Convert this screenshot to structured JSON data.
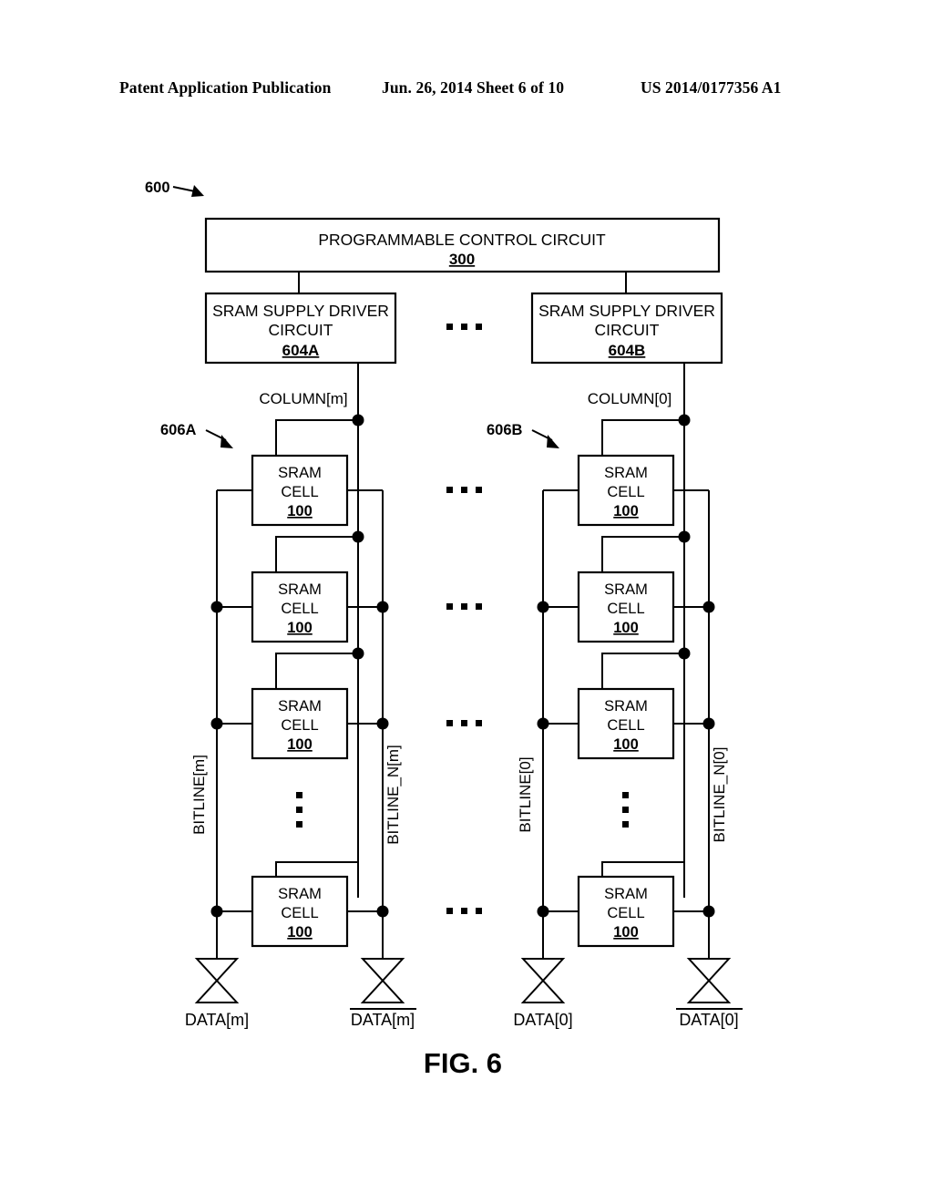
{
  "header": {
    "left": "Patent Application Publication",
    "middle": "Jun. 26, 2014  Sheet 6 of 10",
    "right": "US 2014/0177356 A1"
  },
  "figure": {
    "caption": "FIG. 6",
    "diagram_ref": "600",
    "control_circuit": {
      "title": "PROGRAMMABLE CONTROL CIRCUIT",
      "ref": "300"
    },
    "ellipsis_horizontal": "...",
    "ellipsis_vertical": "⋮",
    "drivers": [
      {
        "line1": "SRAM SUPPLY DRIVER",
        "line2": "CIRCUIT",
        "ref": "604A"
      },
      {
        "line1": "SRAM SUPPLY DRIVER",
        "line2": "CIRCUIT",
        "ref": "604B"
      }
    ],
    "columns": [
      {
        "supply_label": "COLUMN[m]",
        "array_ref": "606A",
        "bitline_true": "BITLINE[m]",
        "bitline_complement": "BITLINE_N[m]",
        "data_true": "DATA[m]",
        "data_complement": "DATA[m]",
        "data_complement_overlined": true,
        "cells": [
          {
            "line1": "SRAM",
            "line2": "CELL",
            "ref": "100"
          },
          {
            "line1": "SRAM",
            "line2": "CELL",
            "ref": "100"
          },
          {
            "line1": "SRAM",
            "line2": "CELL",
            "ref": "100"
          },
          {
            "line1": "SRAM",
            "line2": "CELL",
            "ref": "100"
          }
        ]
      },
      {
        "supply_label": "COLUMN[0]",
        "array_ref": "606B",
        "bitline_true": "BITLINE[0]",
        "bitline_complement": "BITLINE_N[0]",
        "data_true": "DATA[0]",
        "data_complement": "DATA[0]",
        "data_complement_overlined": true,
        "cells": [
          {
            "line1": "SRAM",
            "line2": "CELL",
            "ref": "100"
          },
          {
            "line1": "SRAM",
            "line2": "CELL",
            "ref": "100"
          },
          {
            "line1": "SRAM",
            "line2": "CELL",
            "ref": "100"
          },
          {
            "line1": "SRAM",
            "line2": "CELL",
            "ref": "100"
          }
        ]
      }
    ]
  }
}
